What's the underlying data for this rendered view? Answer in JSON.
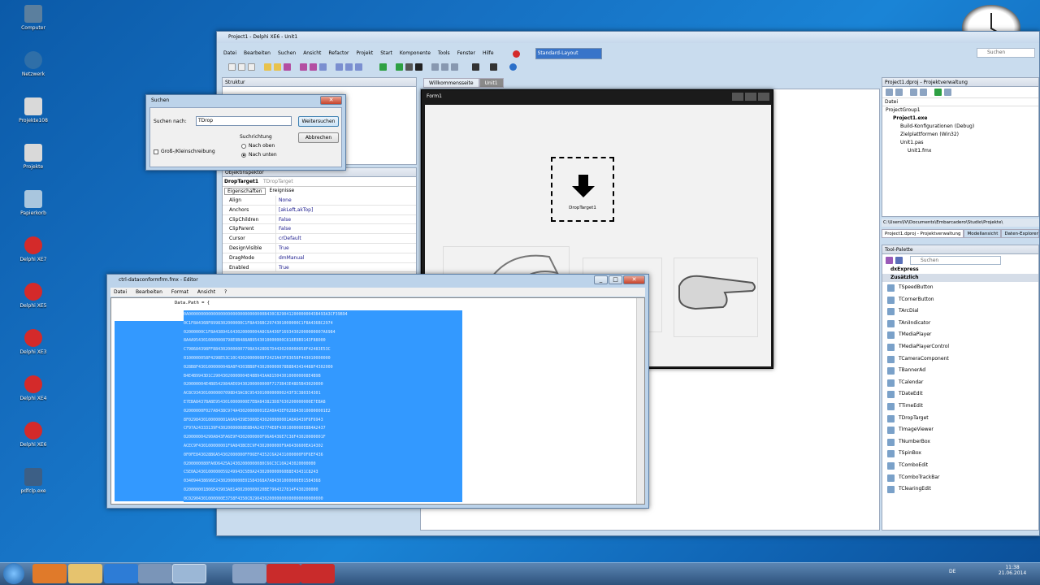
{
  "desktop": {
    "icons": [
      "Computer",
      "Netzwerk",
      "Projekte108",
      "Projekte",
      "Papierkorb",
      "Delphi XE7",
      "Delphi XE5",
      "Delphi XE3",
      "Delphi XE4",
      "Delphi XE6",
      "pdfclp.exe"
    ]
  },
  "ide": {
    "title": "Project1 - Delphi XE6 - Unit1",
    "menu": [
      "Datei",
      "Bearbeiten",
      "Suchen",
      "Ansicht",
      "Refactor",
      "Projekt",
      "Start",
      "Komponente",
      "Tools",
      "Fenster",
      "Hilfe"
    ],
    "layout": "Standard-Layout",
    "search_placeholder": "Suchen",
    "structure_title": "Struktur",
    "tabs": [
      "Willkommensseite",
      "Unit1"
    ],
    "inspector_title": "Objektinspektor",
    "inspector_object": "DropTarget1",
    "inspector_type": "TDropTarget",
    "inspector_tabs": [
      "Eigenschaften",
      "Ereignisse"
    ],
    "properties": [
      {
        "name": "Align",
        "value": "None"
      },
      {
        "name": "Anchors",
        "value": "[akLeft,akTop]"
      },
      {
        "name": "ClipChildren",
        "value": "False"
      },
      {
        "name": "ClipParent",
        "value": "False"
      },
      {
        "name": "Cursor",
        "value": "crDefault"
      },
      {
        "name": "DesignVisible",
        "value": "True"
      },
      {
        "name": "DragMode",
        "value": "dmManual"
      },
      {
        "name": "Enabled",
        "value": "True"
      }
    ],
    "form_title": "Form1",
    "droptarget_label": "DropTarget1",
    "project_title": "Project1.dproj - Projektverwaltung",
    "project_file_label": "Datei",
    "project_tree": [
      {
        "label": "ProjectGroup1",
        "indent": 0,
        "bold": false
      },
      {
        "label": "Project1.exe",
        "indent": 1,
        "bold": true
      },
      {
        "label": "Build-Konfigurationen (Debug)",
        "indent": 2,
        "bold": false
      },
      {
        "label": "Zielplattformen (Win32)",
        "indent": 2,
        "bold": false
      },
      {
        "label": "Unit1.pas",
        "indent": 2,
        "bold": false
      },
      {
        "label": "Unit1.fmx",
        "indent": 3,
        "bold": false
      }
    ],
    "path": "C:\\Users\\IV\\Documents\\Embarcadero\\Studio\\Projekte\\",
    "bottom_tabs": [
      "Project1.dproj - Projektverwaltung",
      "Modellansicht",
      "Daten-Explorer"
    ],
    "palette_title": "Tool-Palette",
    "palette_search": "Suchen",
    "palette_groups": [
      "dxExpress",
      "Zusätzlich"
    ],
    "palette_items": [
      "TSpeedButton",
      "TCornerButton",
      "TArcDial",
      "TAniIndicator",
      "TMediaPlayer",
      "TMediaPlayerControl",
      "TCameraComponent",
      "TBannerAd",
      "TCalendar",
      "TDateEdit",
      "TTimeEdit",
      "TDropTarget",
      "TImageViewer",
      "TNumberBox",
      "TSpinBox",
      "TComboEdit",
      "TComboTrackBar",
      "TClearingEdit"
    ]
  },
  "search_dialog": {
    "title": "Suchen",
    "label": "Suchen nach:",
    "value": "TDrop",
    "find_button": "Weitersuchen",
    "cancel_button": "Abbrechen",
    "direction_label": "Suchrichtung",
    "up": "Nach oben",
    "down": "Nach unten",
    "match_case": "Groß-/Kleinschreibung"
  },
  "editor": {
    "title": "ctrl-dataconformfrm.fmx - Editor",
    "menu": [
      "Datei",
      "Bearbeiten",
      "Format",
      "Ansicht",
      "?"
    ],
    "first_line": "Data.Path = {",
    "hex_lines": [
      "0A0000000000000000000000000000000B430C8290412000000045B493A3CF39B94",
      "0C1F8A436BF8998302000000C1F8A436BC2974301000000C1F8A436BC2974",
      "02000000C1F8A438941643020000004A8C6A436F16934302000000007A6984",
      "8A4A9543010000008798E9B488AB9543010000000C818E8B9143F88000",
      "C798684398FF8843020000007798A3428D67D4430200000058F42483E53C",
      "0100000058F4298E53C10C43020000008F2423A43F83658F443010000000",
      "028B8F4301000000048A8F4303BB8F430200000078B8B43434488F4302000",
      "B4E4B9943D1C29043020000004E48B943AA8150430100000008E4B9B",
      "020000004E4B8542984AE69430200000000F7173B43E48D5B43020000",
      "AC8C9343010000007098D43AC8C95430100000000243F3C380354301",
      "E7EBA8437BABE9543010000000E7EBA843823D87630200000000E7EBA8",
      "02000000F027A8438C974A43020000001E2A0A43EF02B8430100000001E2",
      "8F0298430100000001A0A9439E5000E430200000001A0A9439F6F6943",
      "CF97A24333139F43020000008E8B4A243774E8F4301000000E8B4A2437",
      "020000004290A843FA6E9F4302000000F96A6436E7C38F43020000001F",
      "ACEC9F430100000001F9A843BCEC9F4302000000F9A6436600EA14302",
      "0F0FE843028B6A54302000000FF06EF4352C6A2431000000F0F6EF436",
      "0200000080FA0D6425A24302000000080C66C3C10A243020000000",
      "C5E0A2430100000059249943C5E0A2430200000060B8E43431C8243",
      "034094438696E24302000000E01584368A7A84301000000E01584368",
      "020000001B06E43903AB1400200000020BE7904327814F430200000",
      "0C02904301000000E3758F4350CB29043020000000000000000000000"
    ]
  },
  "taskbar": {
    "lang": "DE",
    "time": "11:38",
    "date": "21.06.2014"
  }
}
